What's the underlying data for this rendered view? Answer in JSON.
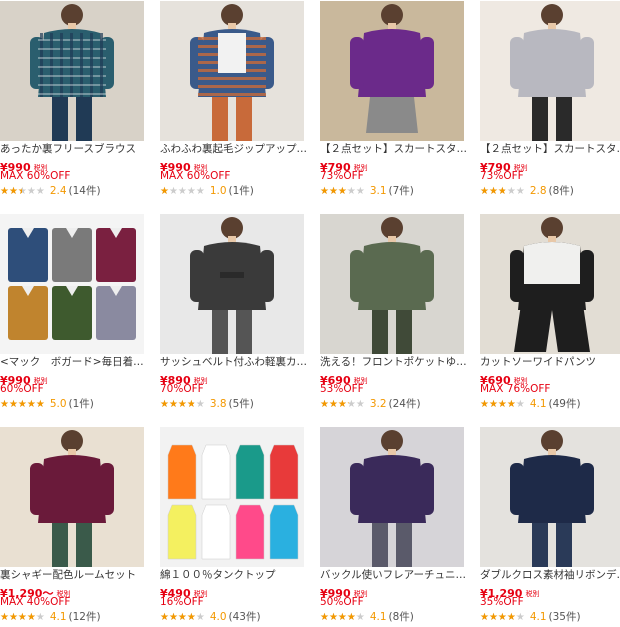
{
  "products": [
    {
      "title": "あったか裏フリースブラウス",
      "price": "¥990",
      "tax": "税別",
      "discount": "MAX 60%OFF",
      "rating": 2.4,
      "score_label": "2.4",
      "count_label": "(14件)"
    },
    {
      "title": "ふわふわ裏起毛ジップアップ…",
      "price": "¥990",
      "tax": "税別",
      "discount": "MAX 60%OFF",
      "rating": 1.0,
      "score_label": "1.0",
      "count_label": "(1件)"
    },
    {
      "title": "【２点セット】スカートスタ…",
      "price": "¥790",
      "tax": "税別",
      "discount": "73%OFF",
      "rating": 3.1,
      "score_label": "3.1",
      "count_label": "(7件)"
    },
    {
      "title": "【２点セット】スカートスタ…",
      "price": "¥790",
      "tax": "税別",
      "discount": "73%OFF",
      "rating": 2.8,
      "score_label": "2.8",
      "count_label": "(8件)"
    },
    {
      "title": "<マック　ボガード>毎日着…",
      "price": "¥990",
      "tax": "税別",
      "discount": "60%OFF",
      "rating": 5.0,
      "score_label": "5.0",
      "count_label": "(1件)"
    },
    {
      "title": "サッシュベルト付ふわ軽裏カ…",
      "price": "¥890",
      "tax": "税別",
      "discount": "70%OFF",
      "rating": 3.8,
      "score_label": "3.8",
      "count_label": "(5件)"
    },
    {
      "title": "洗える！フロントポケットゆ…",
      "price": "¥690",
      "tax": "税別",
      "discount": "53%OFF",
      "rating": 3.2,
      "score_label": "3.2",
      "count_label": "(24件)"
    },
    {
      "title": "カットソーワイドパンツ",
      "price": "¥690",
      "tax": "税別",
      "discount": "MAX 76%OFF",
      "rating": 4.1,
      "score_label": "4.1",
      "count_label": "(49件)"
    },
    {
      "title": "裏シャギー配色ルームセット",
      "price": "¥1,290〜",
      "tax": "税別",
      "discount": "MAX 40%OFF",
      "rating": 4.1,
      "score_label": "4.1",
      "count_label": "(12件)"
    },
    {
      "title": "綿１００％タンクトップ",
      "price": "¥490",
      "tax": "税別",
      "discount": "16%OFF",
      "rating": 4.0,
      "score_label": "4.0",
      "count_label": "(43件)"
    },
    {
      "title": "バックル使いフレアーチュニ…",
      "price": "¥990",
      "tax": "税別",
      "discount": "50%OFF",
      "rating": 4.1,
      "score_label": "4.1",
      "count_label": "(8件)"
    },
    {
      "title": "ダブルクロス素材袖リボンデ…",
      "price": "¥1,290",
      "tax": "税別",
      "discount": "35%OFF",
      "rating": 4.1,
      "score_label": "4.1",
      "count_label": "(35件)"
    }
  ],
  "colors": {
    "price": "#e60012",
    "star": "#f39800",
    "star_empty": "#cccccc"
  }
}
